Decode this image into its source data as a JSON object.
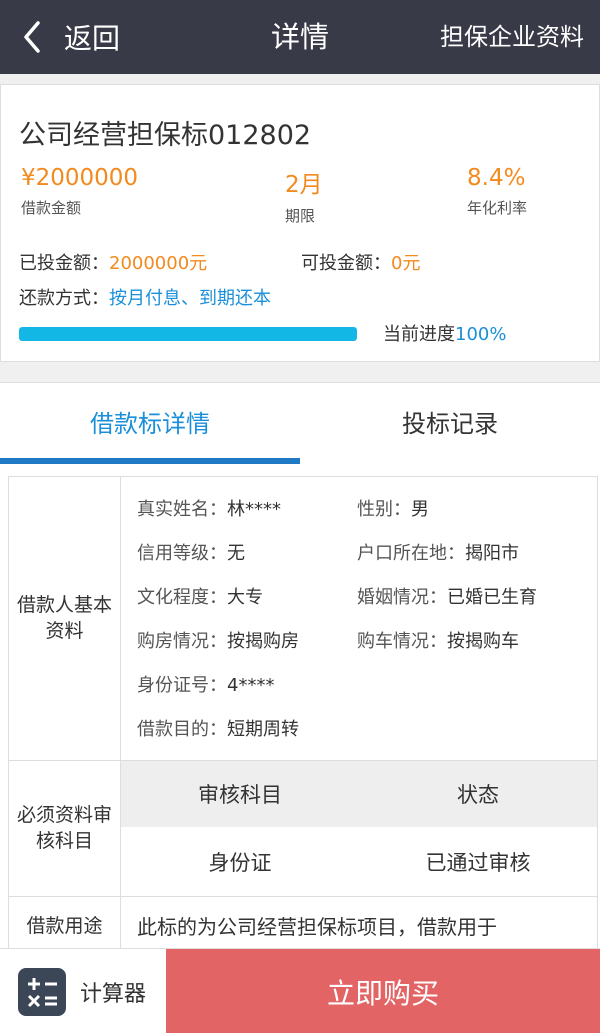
{
  "header": {
    "back_label": "返回",
    "title": "详情",
    "right_link": "担保企业资料"
  },
  "summary": {
    "name": "公司经营担保标012802",
    "amount": "¥2000000",
    "amount_label": "借款金额",
    "term": "2月",
    "term_label": "期限",
    "rate": "8.4%",
    "rate_label": "年化利率",
    "invested_label": "已投金额：",
    "invested_value": "2000000元",
    "available_label": "可投金额：",
    "available_value": "0元",
    "repay_label": "还款方式：",
    "repay_value": "按月付息、到期还本",
    "progress_label": "当前进度",
    "progress_value": "100%",
    "progress_fraction": 1.0
  },
  "tabs": [
    {
      "label": "借款标详情",
      "active": true
    },
    {
      "label": "投标记录",
      "active": false
    }
  ],
  "borrower": {
    "section_label": "借款人基本资料",
    "name_k": "真实姓名：",
    "name_v": "林****",
    "gender_k": "性别：",
    "gender_v": "男",
    "credit_k": "信用等级：",
    "credit_v": "无",
    "hukou_k": "户口所在地：",
    "hukou_v": "揭阳市",
    "edu_k": "文化程度：",
    "edu_v": "大专",
    "marriage_k": "婚姻情况：",
    "marriage_v": "已婚已生育",
    "house_k": "购房情况：",
    "house_v": "按揭购房",
    "car_k": "购车情况：",
    "car_v": "按揭购车",
    "id_k": "身份证号：",
    "id_v": "4****",
    "purpose_k": "借款目的：",
    "purpose_v": "短期周转"
  },
  "review": {
    "section_label": "必须资料审核科目",
    "col_subject": "审核科目",
    "col_status": "状态",
    "rows": [
      {
        "subject": "身份证",
        "status": "已通过审核"
      }
    ]
  },
  "usage": {
    "section_label": "借款用途",
    "text": "此标的为公司经营担保标项目，借款用于"
  },
  "bottom": {
    "calc_label": "计算器",
    "buy_label": "立即购买"
  },
  "colors": {
    "header_bg": "#393a48",
    "accent_orange": "#f28a1e",
    "accent_blue": "#1b8fd9",
    "progress": "#13b7e6",
    "buy_button": "#e26465"
  }
}
